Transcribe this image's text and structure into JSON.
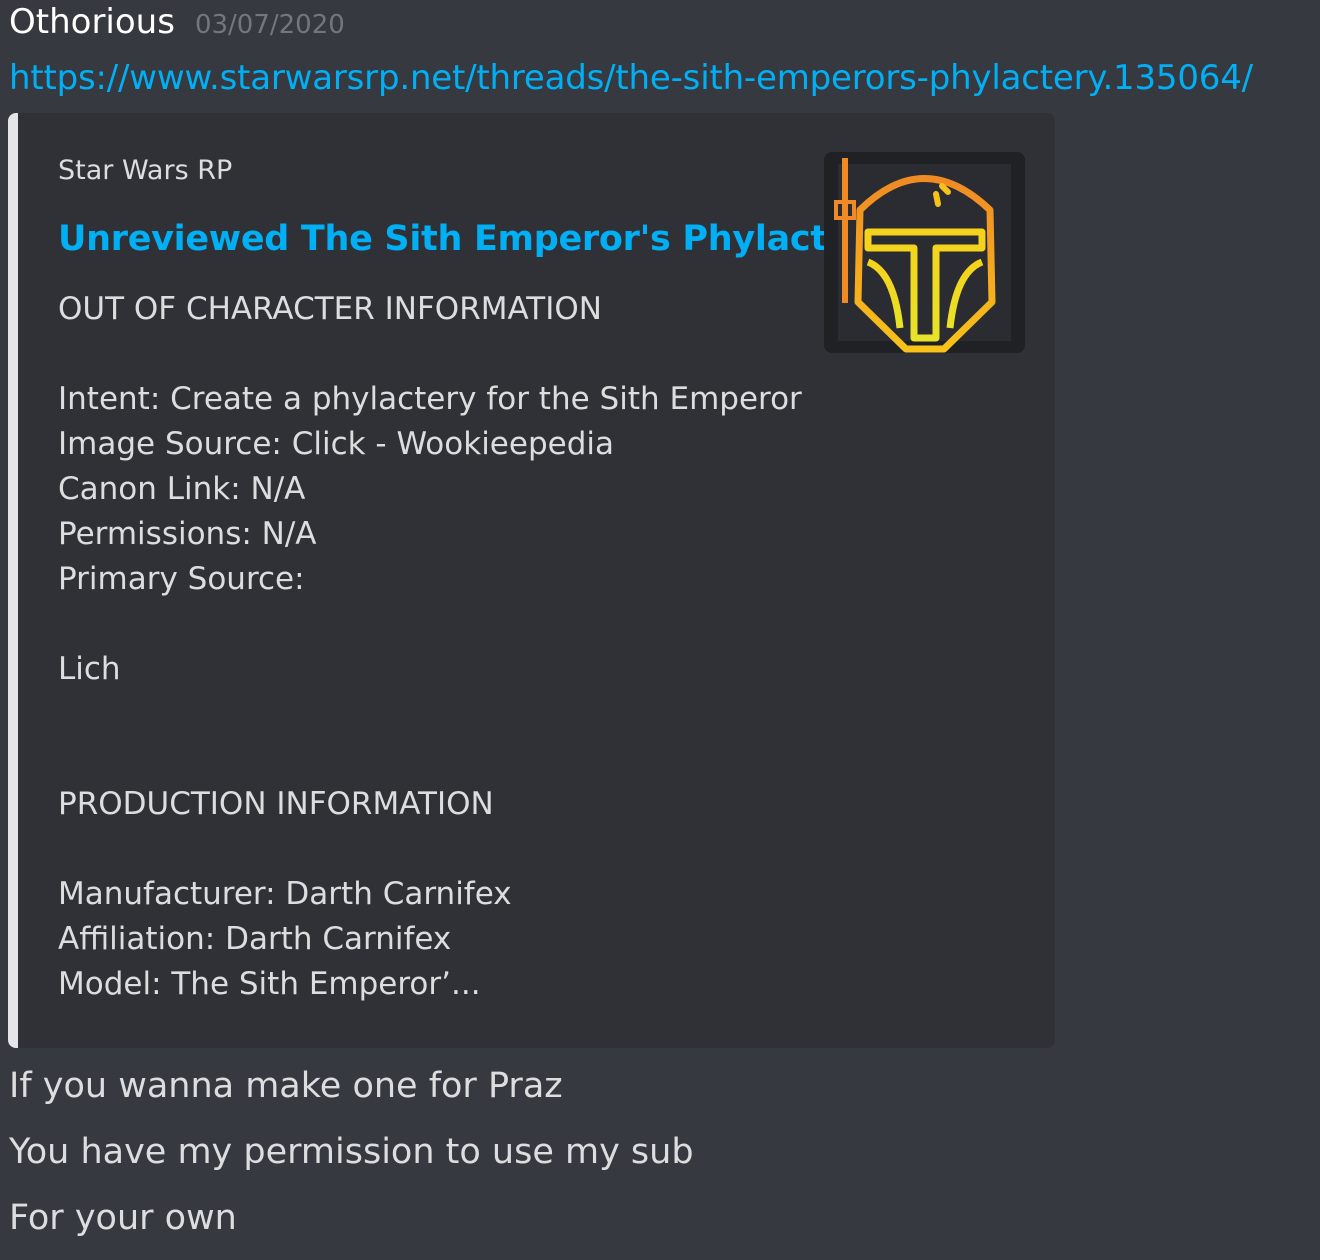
{
  "message": {
    "username": "Othorious",
    "timestamp": "03/07/2020",
    "link": "https://www.starwarsrp.net/threads/the-sith-emperors-phylactery.135064/"
  },
  "embed": {
    "provider": "Star Wars RP",
    "title": "Unreviewed The Sith Emperor's Phylactery",
    "description_lines": [
      "OUT OF CHARACTER INFORMATION",
      "",
      "Intent: Create a phylactery for the Sith Emperor",
      "Image Source: Click - Wookieepedia",
      "Canon Link: N/A",
      "Permissions: N/A",
      "Primary Source:",
      "",
      "Lich",
      "",
      "",
      "PRODUCTION INFORMATION",
      "",
      "Manufacturer: Darth Carnifex",
      "Affiliation: Darth Carnifex",
      "Model: The Sith Emperor’..."
    ],
    "thumbnail_icon": "mandalorian-helmet-icon",
    "accent_color": "#e3e5e8",
    "title_color": "#00aff4"
  },
  "followups": [
    "If you wanna make one for Praz",
    "You have my permission to use my sub",
    "For your own"
  ]
}
